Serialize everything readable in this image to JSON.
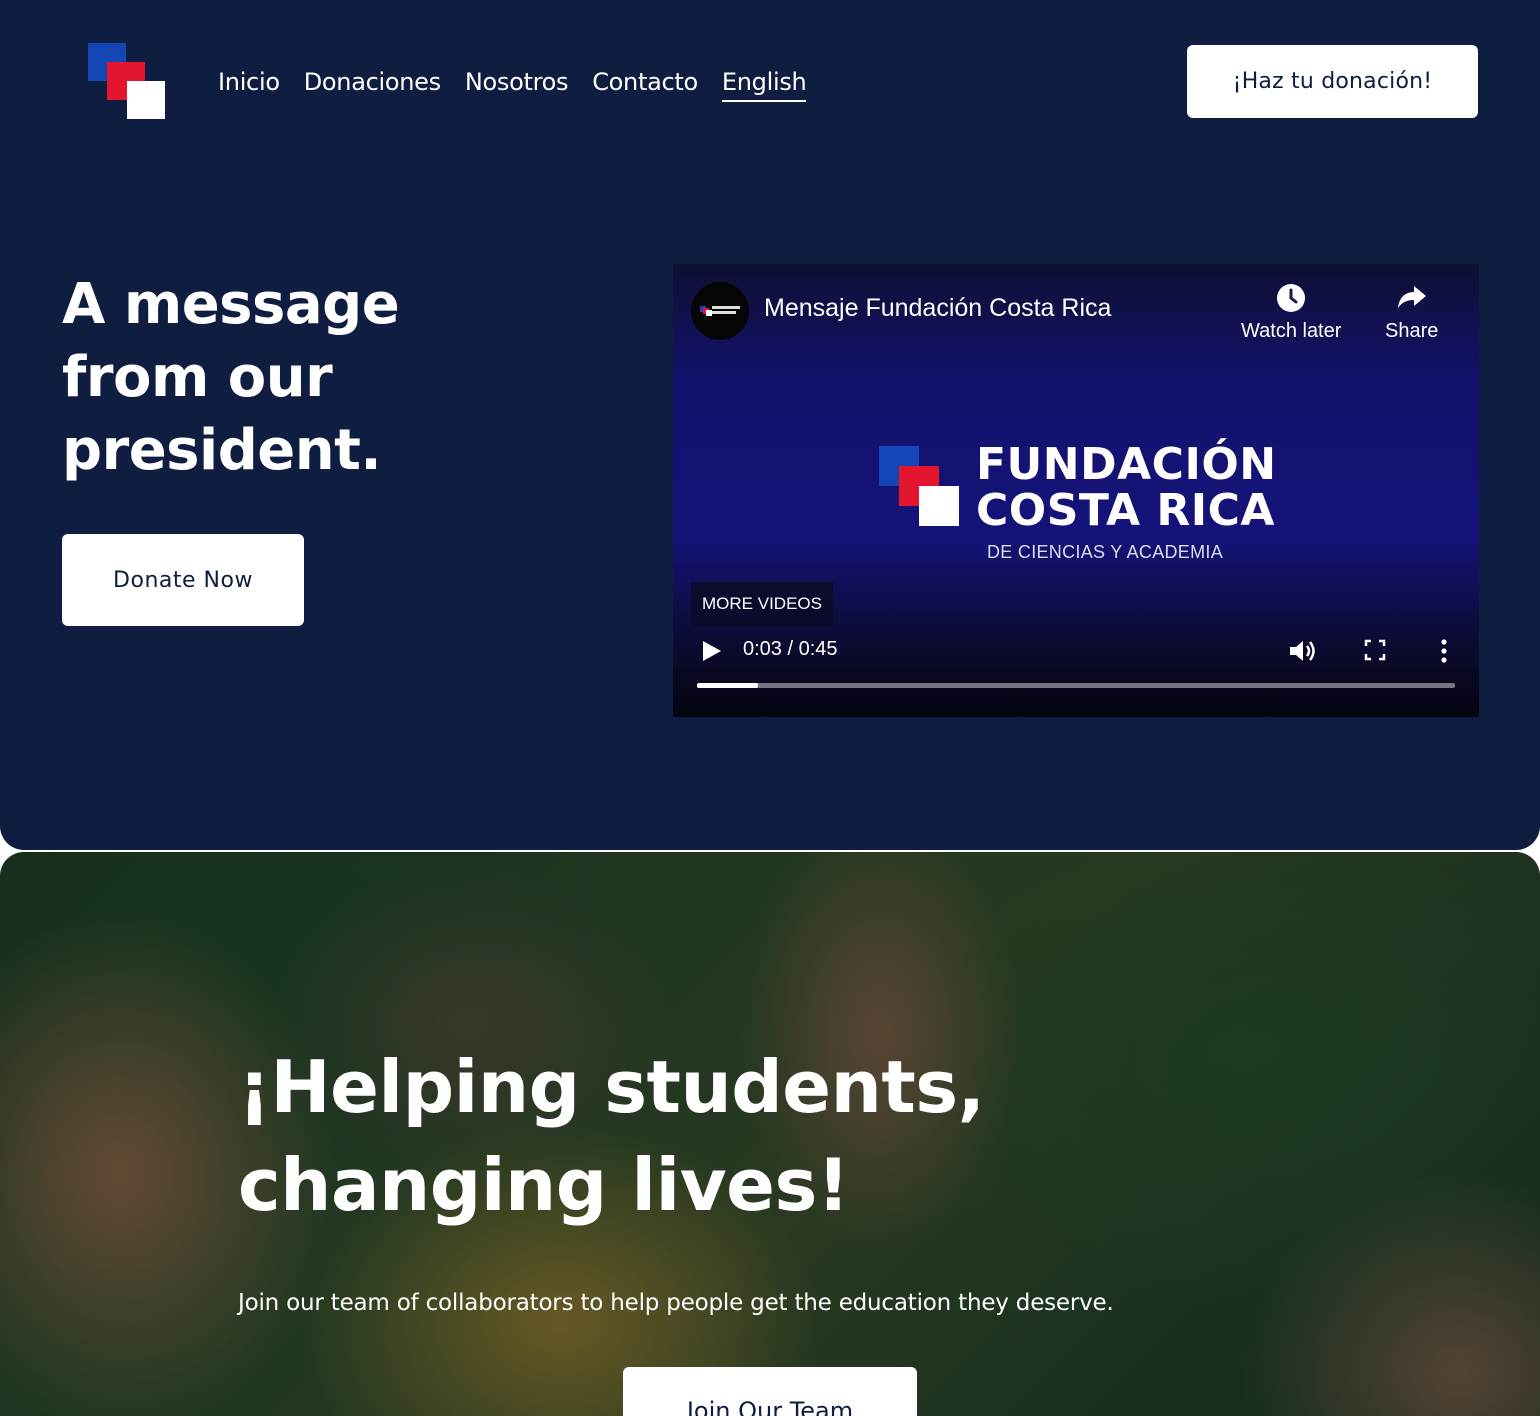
{
  "brand": {
    "logo_colors": [
      "#1546b5",
      "#e3152f",
      "#ffffff"
    ]
  },
  "nav": {
    "items": [
      {
        "label": "Inicio"
      },
      {
        "label": "Donaciones"
      },
      {
        "label": "Nosotros"
      },
      {
        "label": "Contacto"
      },
      {
        "label": "English",
        "active": true
      }
    ],
    "cta_label": "¡Haz tu donación!"
  },
  "hero": {
    "title": "A message from our president.",
    "button_label": "Donate Now",
    "background_color": "#0f1d40"
  },
  "video": {
    "channel_avatar_icon": "fundacion-logo-icon",
    "title": "Mensaje Fundación Costa Rica",
    "watch_later_label": "Watch later",
    "share_label": "Share",
    "brand_name_line1": "FUNDACIÓN",
    "brand_name_line2": "COSTA RICA",
    "brand_subtitle": "DE CIENCIAS Y ACADEMIA",
    "more_videos_label": "MORE VIDEOS",
    "time": "0:03 / 0:45",
    "progress": 0.08
  },
  "banner": {
    "title": "¡Helping students, changing lives!",
    "text": "Join our team of collaborators to help people get the education they deserve.",
    "button_label": "Join Our Team"
  }
}
